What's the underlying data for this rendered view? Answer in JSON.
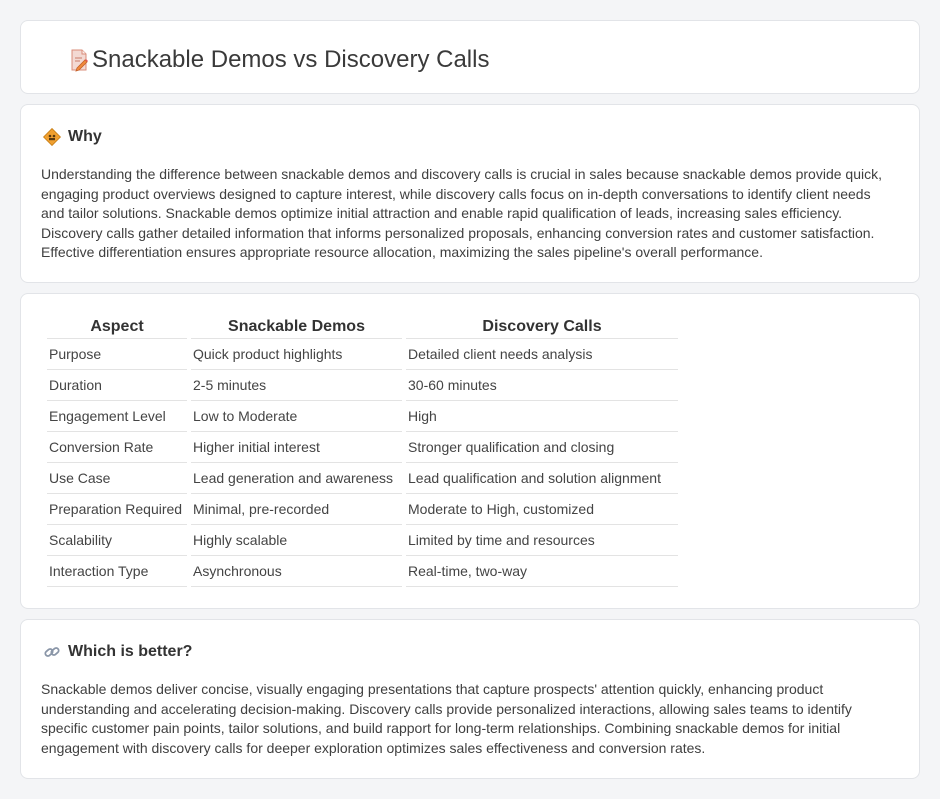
{
  "header": {
    "title": "Snackable Demos vs Discovery Calls",
    "icon": "document-pencil-icon"
  },
  "why": {
    "heading": "Why",
    "icon": "road-sign-icon",
    "text": "Understanding the difference between snackable demos and discovery calls is crucial in sales because snackable demos provide quick, engaging product overviews designed to capture interest, while discovery calls focus on in-depth conversations to identify client needs and tailor solutions. Snackable demos optimize initial attraction and enable rapid qualification of leads, increasing sales efficiency. Discovery calls gather detailed information that informs personalized proposals, enhancing conversion rates and customer satisfaction. Effective differentiation ensures appropriate resource allocation, maximizing the sales pipeline's overall performance."
  },
  "comparison": {
    "headers": [
      "Aspect",
      "Snackable Demos",
      "Discovery Calls"
    ],
    "rows": [
      [
        "Purpose",
        "Quick product highlights",
        "Detailed client needs analysis"
      ],
      [
        "Duration",
        "2-5 minutes",
        "30-60 minutes"
      ],
      [
        "Engagement Level",
        "Low to Moderate",
        "High"
      ],
      [
        "Conversion Rate",
        "Higher initial interest",
        "Stronger qualification and closing"
      ],
      [
        "Use Case",
        "Lead generation and awareness",
        "Lead qualification and solution alignment"
      ],
      [
        "Preparation Required",
        "Minimal, pre-recorded",
        "Moderate to High, customized"
      ],
      [
        "Scalability",
        "Highly scalable",
        "Limited by time and resources"
      ],
      [
        "Interaction Type",
        "Asynchronous",
        "Real-time, two-way"
      ]
    ]
  },
  "better": {
    "heading": "Which is better?",
    "icon": "link-icon",
    "text": "Snackable demos deliver concise, visually engaging presentations that capture prospects' attention quickly, enhancing product understanding and accelerating decision-making. Discovery calls provide personalized interactions, allowing sales teams to identify specific customer pain points, tailor solutions, and build rapport for long-term relationships. Combining snackable demos for initial engagement with discovery calls for deeper exploration optimizes sales effectiveness and conversion rates."
  },
  "colors": {
    "background": "#f4f5f7",
    "card": "#ffffff",
    "border": "#e2e4e8",
    "text": "#333333",
    "accent_orange": "#f0a030"
  }
}
